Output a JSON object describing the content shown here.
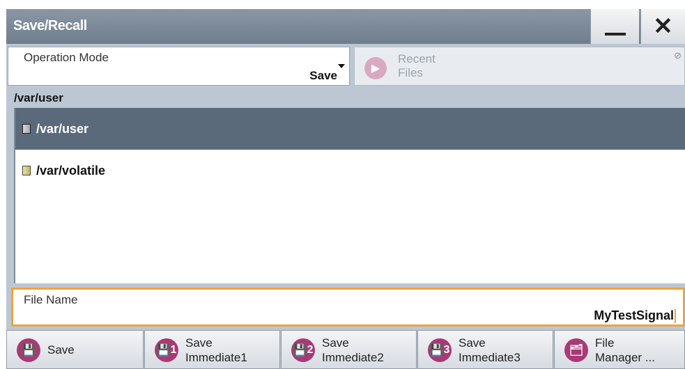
{
  "window": {
    "title": "Save/Recall",
    "minimize_label": "",
    "close_label": "✕"
  },
  "operation_mode": {
    "label": "Operation Mode",
    "value": "Save"
  },
  "recent_files": {
    "line1": "Recent",
    "line2": "Files",
    "corner_mark": "⊘"
  },
  "current_path": "/var/user",
  "file_list": {
    "items": [
      {
        "name": "/var/user",
        "selected": true
      },
      {
        "name": "/var/volatile",
        "selected": false
      }
    ]
  },
  "file_name": {
    "label": "File Name",
    "value": "MyTestSignal"
  },
  "buttons": {
    "save": {
      "line1": "Save",
      "icon_num": ""
    },
    "save_immediate1": {
      "line1": "Save",
      "line2": "Immediate1",
      "icon_num": "1"
    },
    "save_immediate2": {
      "line1": "Save",
      "line2": "Immediate2",
      "icon_num": "2"
    },
    "save_immediate3": {
      "line1": "Save",
      "line2": "Immediate3",
      "icon_num": "3"
    },
    "file_manager": {
      "line1": "File",
      "line2": "Manager ..."
    }
  },
  "colors": {
    "accent": "#f2a23a",
    "button_icon": "#a83a75",
    "selection": "#5a6a7b"
  }
}
